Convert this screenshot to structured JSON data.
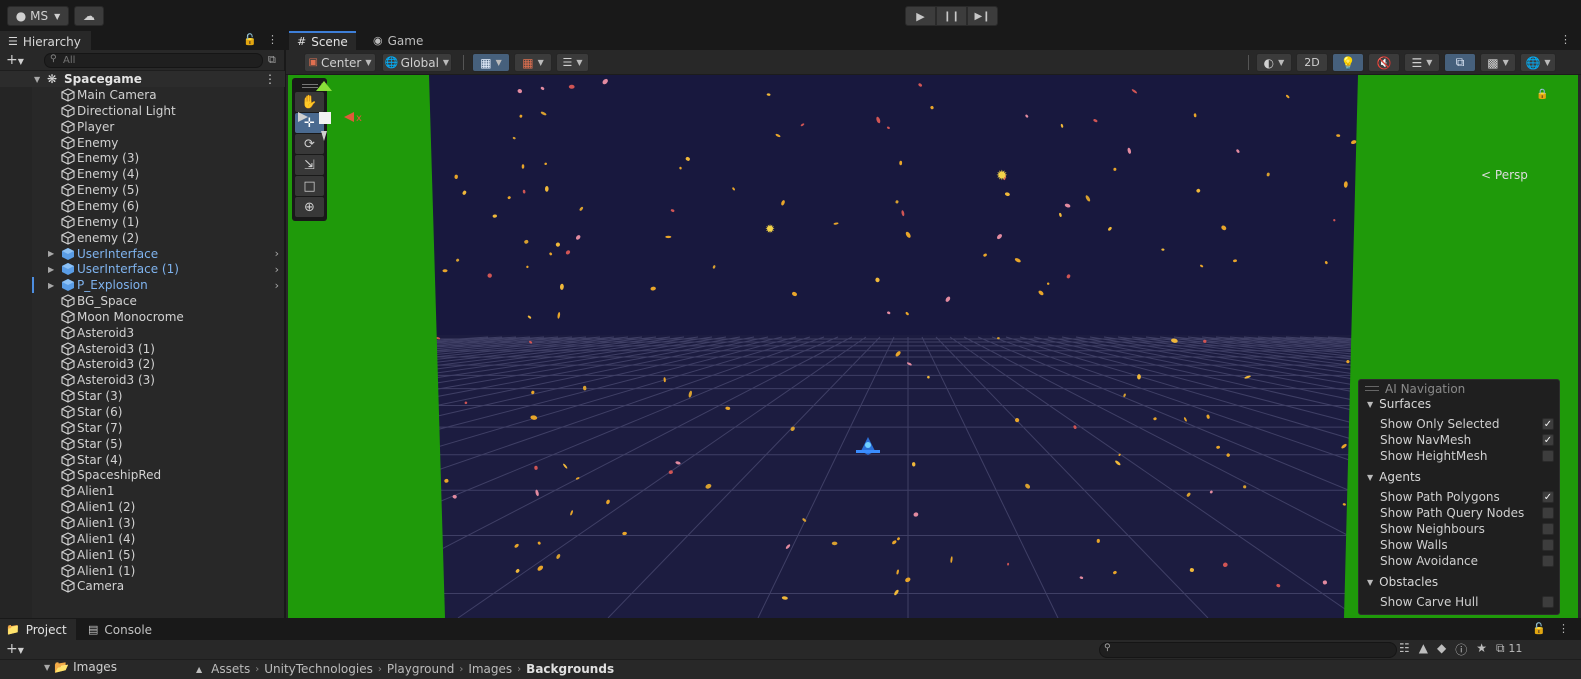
{
  "topbar": {
    "account_label": "MS"
  },
  "hierarchy": {
    "tab_label": "Hierarchy",
    "search_placeholder": "All",
    "scene_name": "Spacegame",
    "items": [
      {
        "label": "Main Camera",
        "prefab": false
      },
      {
        "label": "Directional Light",
        "prefab": false
      },
      {
        "label": "Player",
        "prefab": false
      },
      {
        "label": "Enemy",
        "prefab": false
      },
      {
        "label": "Enemy (3)",
        "prefab": false
      },
      {
        "label": "Enemy (4)",
        "prefab": false
      },
      {
        "label": "Enemy (5)",
        "prefab": false
      },
      {
        "label": "Enemy (6)",
        "prefab": false
      },
      {
        "label": "Enemy (1)",
        "prefab": false
      },
      {
        "label": "enemy (2)",
        "prefab": false
      },
      {
        "label": "UserInterface",
        "prefab": true
      },
      {
        "label": "UserInterface (1)",
        "prefab": true
      },
      {
        "label": "P_Explosion",
        "prefab": true
      },
      {
        "label": "BG_Space",
        "prefab": false
      },
      {
        "label": "Moon Monocrome",
        "prefab": false
      },
      {
        "label": "Asteroid3",
        "prefab": false
      },
      {
        "label": "Asteroid3 (1)",
        "prefab": false
      },
      {
        "label": "Asteroid3 (2)",
        "prefab": false
      },
      {
        "label": "Asteroid3 (3)",
        "prefab": false
      },
      {
        "label": "Star (3)",
        "prefab": false
      },
      {
        "label": "Star (6)",
        "prefab": false
      },
      {
        "label": "Star (7)",
        "prefab": false
      },
      {
        "label": "Star (5)",
        "prefab": false
      },
      {
        "label": "Star (4)",
        "prefab": false
      },
      {
        "label": "SpaceshipRed",
        "prefab": false
      },
      {
        "label": "Alien1",
        "prefab": false
      },
      {
        "label": "Alien1 (2)",
        "prefab": false
      },
      {
        "label": "Alien1 (3)",
        "prefab": false
      },
      {
        "label": "Alien1 (4)",
        "prefab": false
      },
      {
        "label": "Alien1 (5)",
        "prefab": false
      },
      {
        "label": "Alien1 (1)",
        "prefab": false
      },
      {
        "label": "Camera",
        "prefab": false
      }
    ]
  },
  "scene_view": {
    "tabs": [
      "Scene",
      "Game"
    ],
    "pivot_mode": "Center",
    "pivot_rotation": "Global",
    "mode_2d": "2D",
    "camera_mode": "Persp",
    "gizmo_axes": {
      "y": "y",
      "x": "x"
    },
    "colors": {
      "sky": "#18183e",
      "side_walls": "#1f9a0a",
      "grid": "#4a4a6a",
      "selection_accent": "#3e7fd8"
    }
  },
  "ai_navigation": {
    "title": "AI Navigation",
    "sections": [
      {
        "title": "Surfaces",
        "options": [
          {
            "label": "Show Only Selected",
            "checked": true
          },
          {
            "label": "Show NavMesh",
            "checked": true
          },
          {
            "label": "Show HeightMesh",
            "checked": false
          }
        ]
      },
      {
        "title": "Agents",
        "options": [
          {
            "label": "Show Path Polygons",
            "checked": true
          },
          {
            "label": "Show Path Query Nodes",
            "checked": false
          },
          {
            "label": "Show Neighbours",
            "checked": false
          },
          {
            "label": "Show Walls",
            "checked": false
          },
          {
            "label": "Show Avoidance",
            "checked": false
          }
        ]
      },
      {
        "title": "Obstacles",
        "options": [
          {
            "label": "Show Carve Hull",
            "checked": false
          }
        ]
      }
    ]
  },
  "project": {
    "tabs": [
      "Project",
      "Console"
    ],
    "folder_label": "Images",
    "hidden_count": "11",
    "breadcrumbs": [
      "Assets",
      "UnityTechnologies",
      "Playground",
      "Images",
      "Backgrounds"
    ]
  }
}
